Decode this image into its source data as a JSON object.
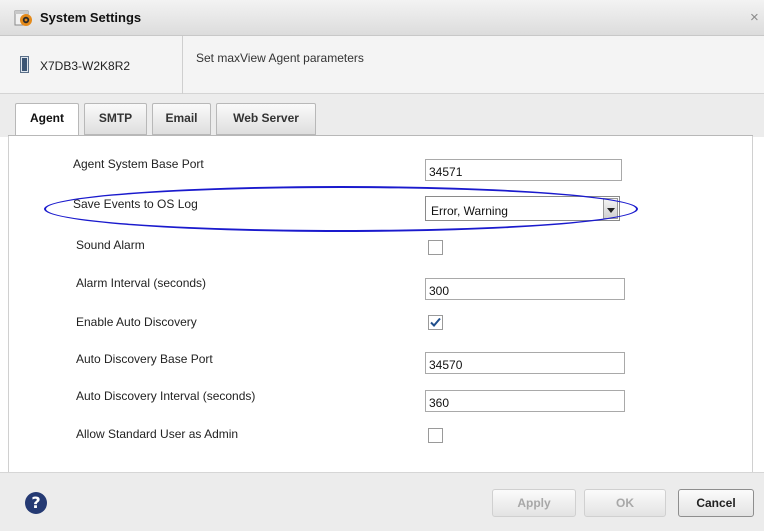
{
  "window": {
    "title": "System Settings",
    "close_symbol": "×"
  },
  "server": {
    "name": "X7DB3-W2K8R2",
    "description": "Set maxView Agent parameters"
  },
  "tabs": [
    {
      "label": "Agent",
      "active": true
    },
    {
      "label": "SMTP",
      "active": false
    },
    {
      "label": "Email",
      "active": false
    },
    {
      "label": "Web Server",
      "active": false
    }
  ],
  "agent": {
    "base_port": {
      "label": "Agent System Base Port",
      "value": "34571"
    },
    "save_events": {
      "label": "Save Events to OS Log",
      "value": "Error, Warning"
    },
    "sound_alarm": {
      "label": "Sound Alarm",
      "checked": false
    },
    "alarm_interval": {
      "label": "Alarm Interval (seconds)",
      "value": "300"
    },
    "auto_discovery": {
      "label": "Enable Auto Discovery",
      "checked": true
    },
    "discovery_port": {
      "label": "Auto Discovery Base Port",
      "value": "34570"
    },
    "discovery_interval": {
      "label": "Auto Discovery Interval (seconds)",
      "value": "360"
    },
    "standard_admin": {
      "label": "Allow Standard User as Admin",
      "checked": false
    }
  },
  "footer": {
    "help_symbol": "?",
    "apply_label": "Apply",
    "ok_label": "OK",
    "cancel_label": "Cancel"
  },
  "colors": {
    "highlight_ellipse": "#1a1acd",
    "help_icon": "#253a73",
    "check_mark": "#1f4e8c"
  }
}
